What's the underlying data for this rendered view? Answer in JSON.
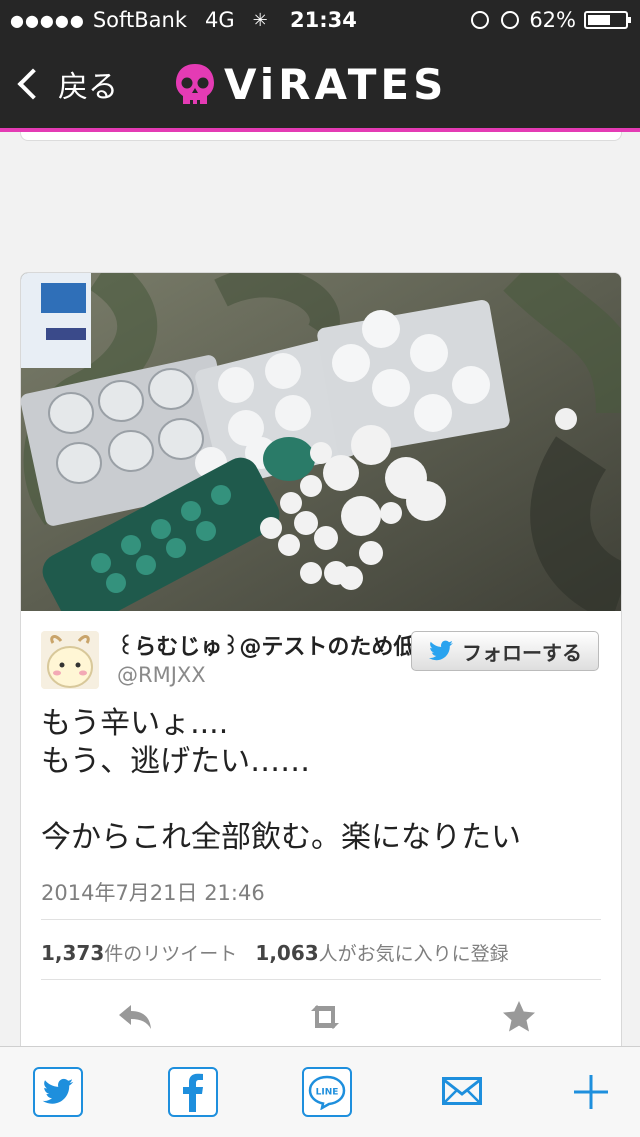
{
  "status_bar": {
    "signal_dots": "●●●●●",
    "carrier": "SoftBank",
    "network": "4G",
    "time": "21:34",
    "battery_percent": "62%",
    "battery_level": 0.62
  },
  "nav": {
    "back_label": "戻る",
    "logo_text": "ViRATES",
    "accent_color": "#e43bb4"
  },
  "tweet": {
    "display_name": "꒰らむじゅ꒱@テストのため低浮上",
    "username": "@RMJXX",
    "follow_label": "フォローする",
    "text_lines": [
      "もう辛いょ....",
      "もう、逃げたい……",
      "",
      "今からこれ全部飲む。楽になりたい"
    ],
    "timestamp": "2014年7月21日 21:46",
    "retweet_count": "1,373",
    "retweet_label": "件のリツイート",
    "favorite_count": "1,063",
    "favorite_label": "人がお気に入りに登録"
  },
  "actions": {
    "reply": "reply-icon",
    "retweet": "retweet-icon",
    "favorite": "star-icon"
  },
  "share_bar": {
    "items": [
      "twitter-icon",
      "facebook-icon",
      "line-icon",
      "mail-icon",
      "plus-icon"
    ],
    "line_label": "LINE",
    "brand_color": "#1e8fdd"
  }
}
